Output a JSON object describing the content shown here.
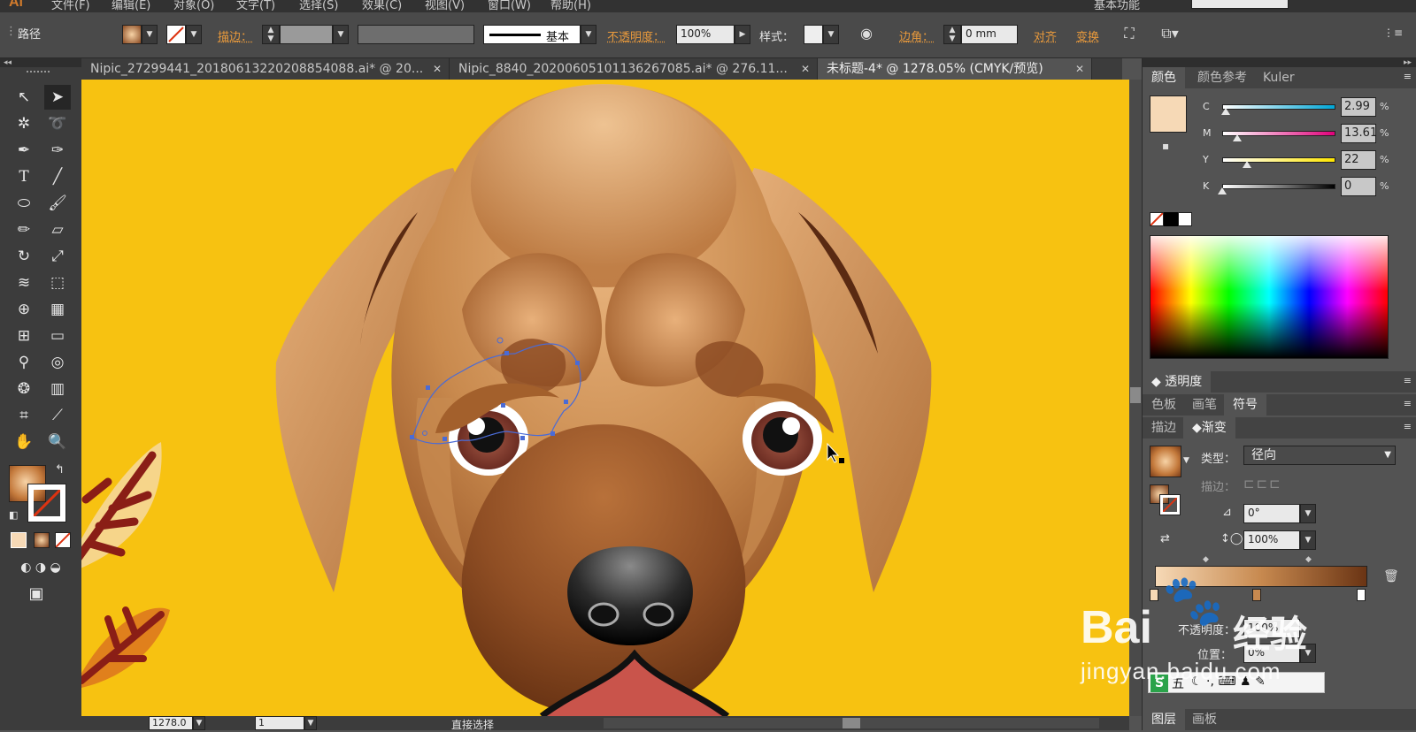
{
  "app": {
    "logo": "Ai",
    "menu": [
      "文件(F)",
      "编辑(E)",
      "对象(O)",
      "文字(T)",
      "选择(S)",
      "效果(C)",
      "视图(V)",
      "窗口(W)",
      "帮助(H)"
    ],
    "workspace": "基本功能"
  },
  "control": {
    "selection_type": "路径",
    "stroke_label": "描边：",
    "stroke_style": "基本",
    "opacity_label": "不透明度：",
    "opacity_value": "100%",
    "style_label": "样式：",
    "corner_label": "边角：",
    "corner_value": "0 mm",
    "align_label": "对齐",
    "transform_label": "变换"
  },
  "tabs": [
    {
      "label": "Nipic_27299441_20180613220208854088.ai* @ 20...",
      "active": false
    },
    {
      "label": "Nipic_8840_20200605101136267085.ai* @ 276.11...",
      "active": false
    },
    {
      "label": "未标题-4* @ 1278.05% (CMYK/预览)",
      "active": true
    }
  ],
  "color_panel": {
    "tabs": [
      "颜色",
      "颜色参考",
      "Kuler"
    ],
    "swatch_color": "#f6d9b6",
    "channels": [
      {
        "name": "C",
        "value": "2.99",
        "fraction": 0.03
      },
      {
        "name": "M",
        "value": "13.61",
        "fraction": 0.136
      },
      {
        "name": "Y",
        "value": "22",
        "fraction": 0.22
      },
      {
        "name": "K",
        "value": "0",
        "fraction": 0.0
      }
    ],
    "pct": "%"
  },
  "transparency_panel": {
    "title": "透明度"
  },
  "swatch_tabs": [
    "色板",
    "画笔",
    "符号"
  ],
  "gradient_panel": {
    "tabs": [
      "描边",
      "渐变"
    ],
    "type_label": "类型：",
    "type_value": "径向",
    "stroke_label": "描边：",
    "angle_value": "0°",
    "aspect_value": "100%",
    "opacity_label": "不透明度：",
    "opacity_value": "100%",
    "location_label": "位置：",
    "location_value": "0%"
  },
  "layers_tabs": [
    "图层",
    "画板"
  ],
  "status": {
    "zoom": "1278.0",
    "artboard": "1",
    "tool": "直接选择"
  },
  "watermark": {
    "brand": "Bai",
    "brand_cn": "经验",
    "url": "jingyan.baidu.com"
  },
  "ime": {
    "label": "五"
  },
  "colors": {
    "canvas_bg": "#f7c211",
    "accent": "#e99a3c",
    "dog_light": "#e8b27c",
    "dog_dark": "#8a4a22"
  }
}
